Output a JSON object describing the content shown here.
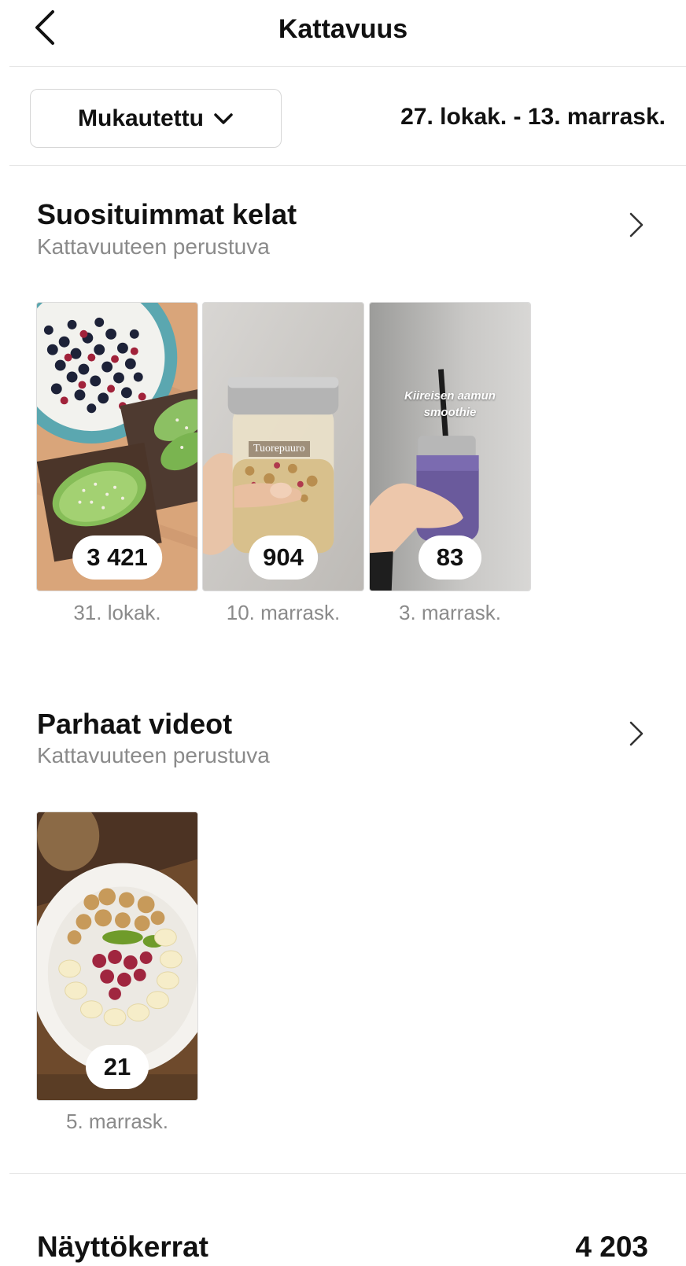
{
  "header": {
    "title": "Kattavuus",
    "back_icon": "chevron-left-icon"
  },
  "filter": {
    "range_label": "Mukautettu",
    "range_icon": "chevron-down-icon",
    "date_range": "27. lokak. - 13. marrask."
  },
  "reels_section": {
    "title": "Suosituimmat kelat",
    "subtitle": "Kattavuuteen perustuva",
    "items": [
      {
        "count": "3 421",
        "date": "31. lokak."
      },
      {
        "count": "904",
        "date": "10. marrask.",
        "overlay_text": "Tuorepuuro"
      },
      {
        "count": "83",
        "date": "3. marrask.",
        "overlay_text_line1": "Kiireisen aamun",
        "overlay_text_line2": "smoothie"
      }
    ]
  },
  "videos_section": {
    "title": "Parhaat videot",
    "subtitle": "Kattavuuteen perustuva",
    "items": [
      {
        "count": "21",
        "date": "5. marrask."
      }
    ]
  },
  "stats": {
    "impressions_label": "Näyttökerrat",
    "impressions_value": "4 203"
  }
}
